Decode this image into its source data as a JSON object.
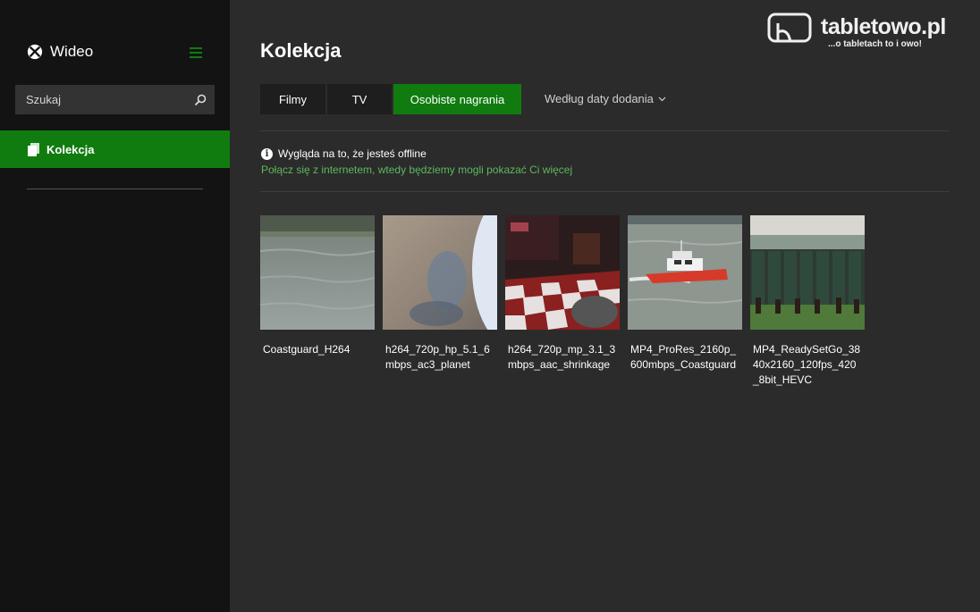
{
  "app": {
    "name": "Wideo"
  },
  "sidebar": {
    "search_placeholder": "Szukaj",
    "items": [
      {
        "label": "Kolekcja"
      }
    ]
  },
  "main": {
    "title": "Kolekcja",
    "tabs": [
      {
        "label": "Filmy",
        "active": false
      },
      {
        "label": "TV",
        "active": false
      },
      {
        "label": "Osobiste nagrania",
        "active": true
      }
    ],
    "sort_label": "Według daty dodania",
    "offline": {
      "message": "Wygląda na to, że jesteś offline",
      "link": "Połącz się z internetem, wtedy będziemy mogli pokazać Ci więcej"
    },
    "videos": [
      {
        "title": "Coastguard_H264"
      },
      {
        "title": "h264_720p_hp_5.1_6mbps_ac3_planet"
      },
      {
        "title": "h264_720p_mp_3.1_3mbps_aac_shrinkage"
      },
      {
        "title": "MP4_ProRes_2160p_600mbps_Coastguard"
      },
      {
        "title": "MP4_ReadySetGo_3840x2160_120fps_420_8bit_HEVC"
      }
    ]
  },
  "watermark": {
    "text": "tabletowo.pl",
    "tagline": "...o tabletach to i owo!"
  },
  "colors": {
    "accent": "#107c10",
    "sidebar_bg": "#131313",
    "main_bg": "#2b2b2b",
    "link": "#5cb85c"
  }
}
